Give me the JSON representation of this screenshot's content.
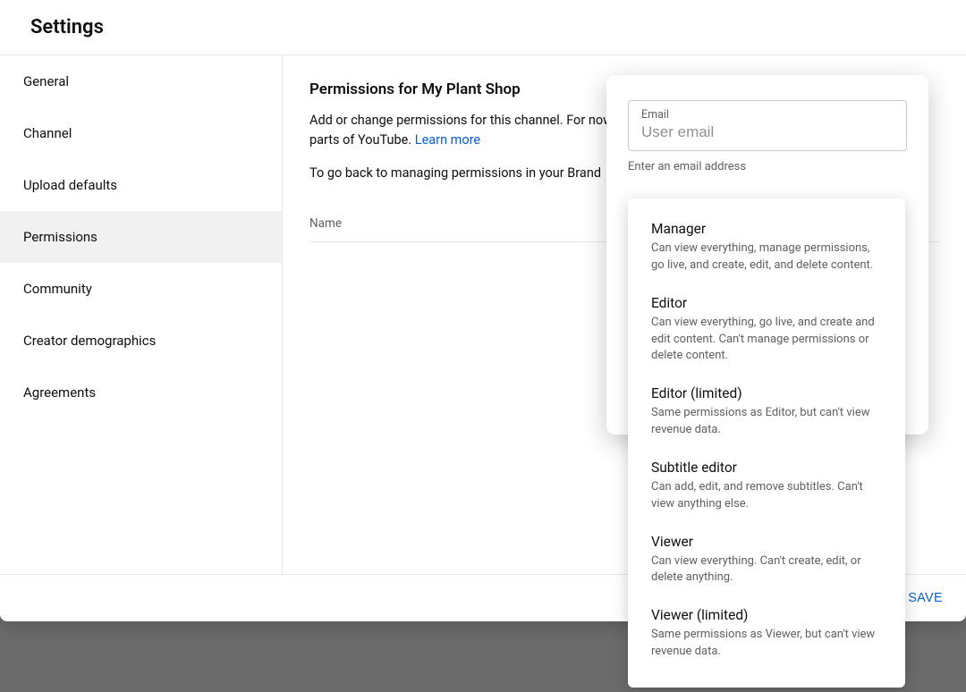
{
  "title": "Settings",
  "sidebar": {
    "items": [
      {
        "label": "General"
      },
      {
        "label": "Channel"
      },
      {
        "label": "Upload defaults"
      },
      {
        "label": "Permissions"
      },
      {
        "label": "Community"
      },
      {
        "label": "Creator demographics"
      },
      {
        "label": "Agreements"
      }
    ],
    "active_index": 3
  },
  "main": {
    "heading": "Permissions for My Plant Shop",
    "desc_part1": "Add or change permissions for this channel. For now, some roles may not have access to all features and parts of YouTube. ",
    "learn_more": "Learn more",
    "back_text": "To go back to managing permissions in your Brand ",
    "table": {
      "name_col": "Name"
    }
  },
  "footer": {
    "save": "SAVE"
  },
  "invite": {
    "email_label": "Email",
    "email_placeholder": "User email",
    "helper": "Enter an email address"
  },
  "roles": [
    {
      "title": "Manager",
      "desc": "Can view everything, manage permissions, go live, and create, edit, and delete content."
    },
    {
      "title": "Editor",
      "desc": "Can view everything, go live, and create and edit content. Can't manage permissions or delete content."
    },
    {
      "title": "Editor (limited)",
      "desc": "Same permissions as Editor, but can't view revenue data."
    },
    {
      "title": "Subtitle editor",
      "desc": "Can add, edit, and remove subtitles. Can't view anything else."
    },
    {
      "title": "Viewer",
      "desc": "Can view everything. Can't create, edit, or delete anything."
    },
    {
      "title": "Viewer (limited)",
      "desc": "Same permissions as Viewer, but can't view revenue data."
    }
  ]
}
